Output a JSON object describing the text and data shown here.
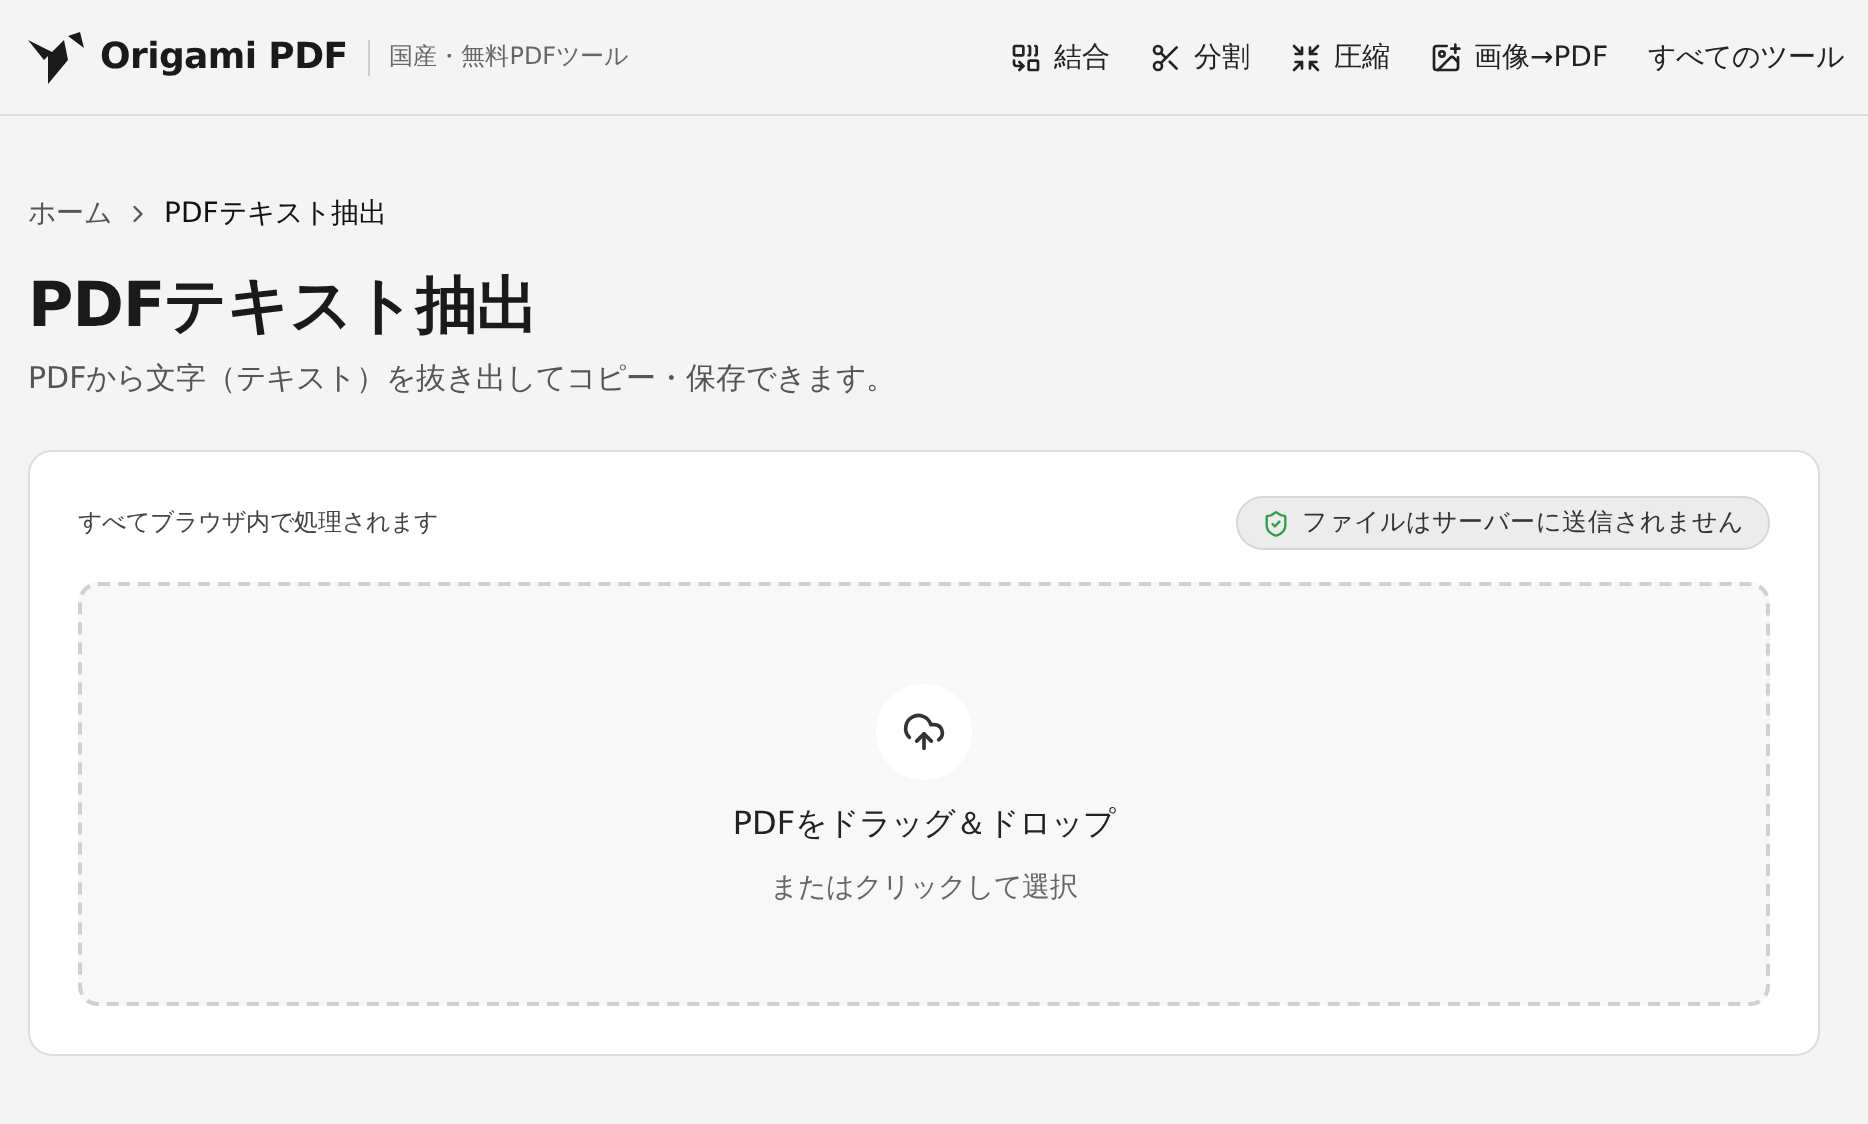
{
  "header": {
    "brand": "Origami PDF",
    "tagline": "国産・無料PDFツール",
    "nav": [
      {
        "kind": "merge",
        "label": "結合"
      },
      {
        "kind": "split",
        "label": "分割"
      },
      {
        "kind": "compress",
        "label": "圧縮"
      },
      {
        "kind": "image",
        "label": "画像→PDF"
      },
      {
        "kind": "all",
        "label": "すべてのツール"
      }
    ]
  },
  "breadcrumb": [
    "ホーム",
    "PDFテキスト抽出"
  ],
  "title": "PDFテキスト抽出",
  "subtitle": "PDFから文字（テキスト）を抜き出してコピー・保存できます。",
  "panel": {
    "note": "すべてブラウザ内で処理されます",
    "badge": "ファイルはサーバーに送信されません",
    "dropzone": {
      "title": "PDFをドラッグ＆ドロップ",
      "hint": "またはクリックして選択"
    }
  }
}
